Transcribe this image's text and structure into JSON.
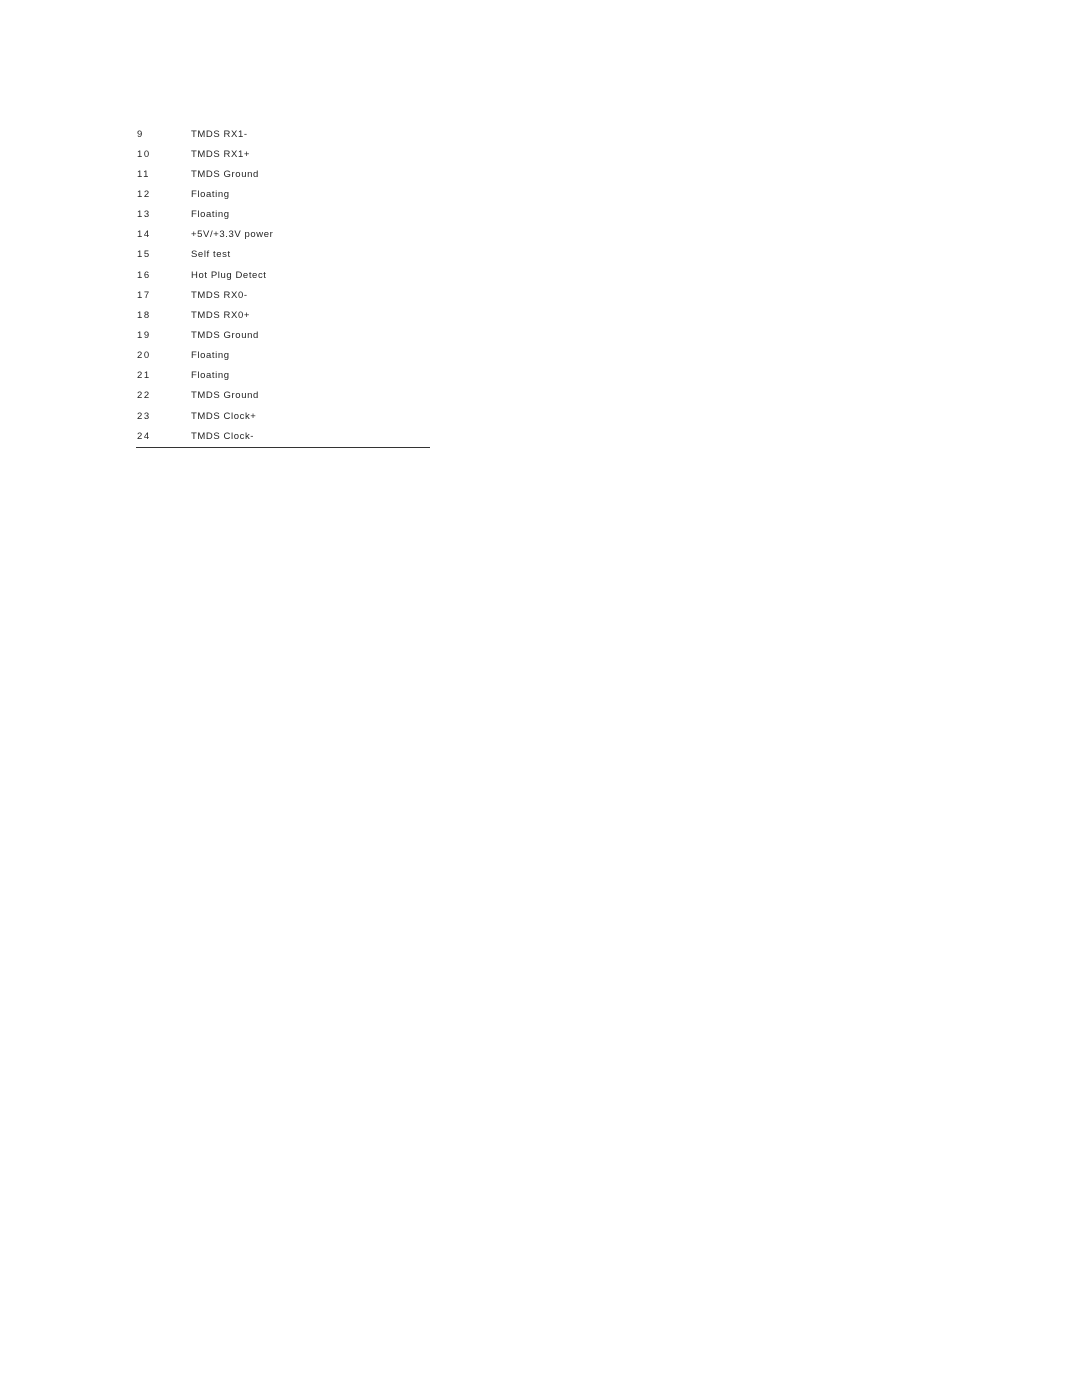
{
  "pin_table": {
    "rows": [
      {
        "pin": "9",
        "signal": "TMDS RX1-"
      },
      {
        "pin": "10",
        "signal": "TMDS RX1+"
      },
      {
        "pin": "11",
        "signal": "TMDS Ground"
      },
      {
        "pin": "12",
        "signal": "Floating"
      },
      {
        "pin": "13",
        "signal": "Floating"
      },
      {
        "pin": "14",
        "signal": "+5V/+3.3V power"
      },
      {
        "pin": "15",
        "signal": "Self test"
      },
      {
        "pin": "16",
        "signal": "Hot Plug Detect"
      },
      {
        "pin": "17",
        "signal": "TMDS RX0-"
      },
      {
        "pin": "18",
        "signal": "TMDS RX0+"
      },
      {
        "pin": "19",
        "signal": "TMDS Ground"
      },
      {
        "pin": "20",
        "signal": "Floating"
      },
      {
        "pin": "21",
        "signal": "Floating"
      },
      {
        "pin": "22",
        "signal": "TMDS Ground"
      },
      {
        "pin": "23",
        "signal": "TMDS Clock+"
      },
      {
        "pin": "24",
        "signal": "TMDS Clock-"
      }
    ]
  }
}
